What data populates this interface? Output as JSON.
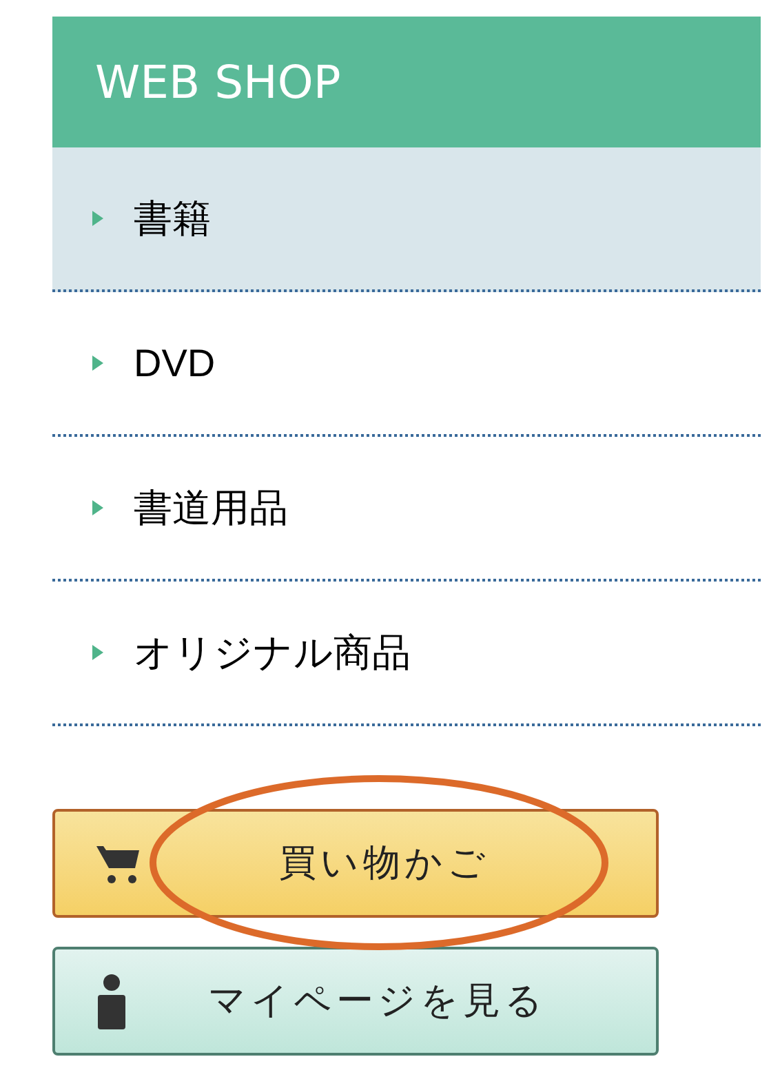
{
  "header": {
    "title": "WEB SHOP"
  },
  "menu": [
    {
      "label": "書籍",
      "selected": true
    },
    {
      "label": "DVD",
      "selected": false
    },
    {
      "label": "書道用品",
      "selected": false
    },
    {
      "label": "オリジナル商品",
      "selected": false
    }
  ],
  "buttons": [
    {
      "kind": "cart",
      "label": "買い物かご"
    },
    {
      "kind": "mypage",
      "label": "マイページを見る"
    }
  ]
}
